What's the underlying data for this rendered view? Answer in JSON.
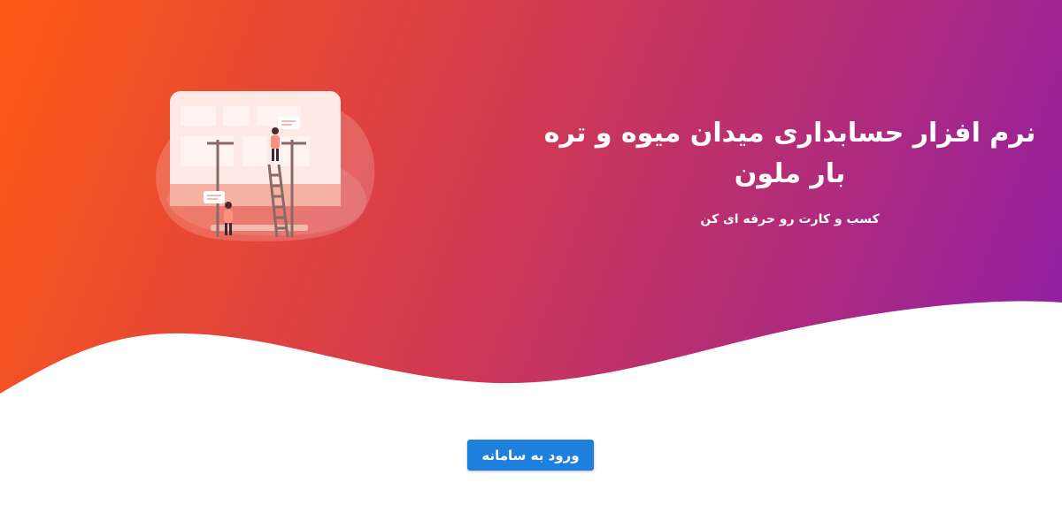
{
  "hero": {
    "title": "نرم افزار حسابداری میدان میوه و تره بار ملون",
    "subtitle": "کسب و کارت رو حرفه ای کن"
  },
  "login": {
    "label": "ورود به سامانه"
  },
  "colors": {
    "gradient_start": "#ff5a14",
    "gradient_mid": "#d33a4f",
    "gradient_end": "#8f1ea6",
    "button": "#1f7fdc"
  },
  "icons": {
    "illustration": "workers-at-board-illustration"
  }
}
